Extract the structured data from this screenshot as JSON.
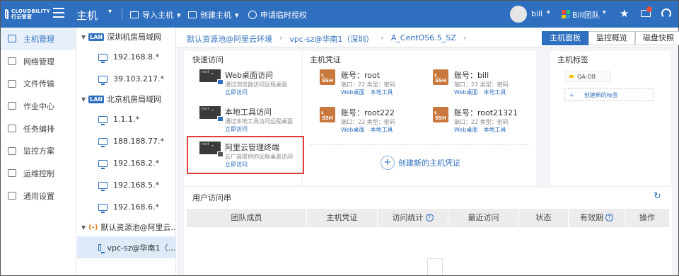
{
  "header": {
    "logo_text_line1": "CLOUDBILITY",
    "logo_text_line2": "行云管家",
    "title": "主机",
    "actions": [
      {
        "label": "导入主机",
        "icon": "import-icon"
      },
      {
        "label": "创建主机",
        "icon": "create-host-icon"
      },
      {
        "label": "申请临时授权",
        "icon": "clock-icon"
      }
    ],
    "user": "bill",
    "team": "Bill团队"
  },
  "left_nav": {
    "items": [
      {
        "label": "主机管理",
        "icon": "monitor-icon",
        "active": true
      },
      {
        "label": "网络管理",
        "icon": "network-icon",
        "active": false
      },
      {
        "label": "文件传输",
        "icon": "file-transfer-icon",
        "active": false
      },
      {
        "label": "作业中心",
        "icon": "job-center-icon",
        "active": false
      },
      {
        "label": "任务编排",
        "icon": "task-icon",
        "active": false
      },
      {
        "label": "监控方案",
        "icon": "monitoring-icon",
        "active": false
      },
      {
        "label": "运维控制",
        "icon": "ops-control-icon",
        "active": false
      },
      {
        "label": "通用设置",
        "icon": "settings-icon",
        "active": false
      }
    ]
  },
  "host_tree": {
    "groups": [
      {
        "badge": "LAN",
        "label": "深圳机房局域网",
        "hosts": [
          "192.168.8.*",
          "39.103.217.*"
        ]
      },
      {
        "badge": "LAN",
        "label": "北京机房局域网",
        "hosts": [
          "1.1.1.*",
          "188.188.77.*",
          "192.168.2.*",
          "192.168.5.*",
          "192.168.6.*"
        ]
      },
      {
        "badge": "(-)",
        "label": "默认资源池@阿里云...",
        "hosts": [
          "vpc-sz@华南1（..."
        ]
      }
    ]
  },
  "breadcrumb": [
    "默认资源池@阿里云环境",
    "vpc-sz@华南1（深圳）",
    "A_CentOS6.5_SZ"
  ],
  "view_tabs": [
    "主机面板",
    "监控概览",
    "磁盘快照"
  ],
  "quick_access": {
    "title": "快速访问",
    "items": [
      {
        "title": "Web桌面访问",
        "desc": "通过浏览器访问远程桌面",
        "link": "立即访问"
      },
      {
        "title": "本地工具访问",
        "desc": "通过本地工具访问远程桌面",
        "link": "立即访问"
      },
      {
        "title": "阿里云管理终端",
        "desc": "云厂商提供的远程桌面访问",
        "link": "立即访问"
      }
    ]
  },
  "credentials": {
    "title": "主机凭证",
    "items": [
      {
        "account": "账号：root",
        "meta": "端口：22  类型：密码",
        "links": [
          "Web桌面",
          "本地工具"
        ]
      },
      {
        "account": "账号：bill",
        "meta": "端口：22  类型：密码",
        "links": [
          "Web桌面",
          "本地工具"
        ]
      },
      {
        "account": "账号：root222",
        "meta": "端口：22  类型：密码",
        "links": [
          "Web桌面",
          "本地工具"
        ]
      },
      {
        "account": "账号：root21321",
        "meta": "端口：22  类型：密码",
        "links": [
          "Web桌面",
          "本地工具"
        ]
      }
    ],
    "badge": "SSH",
    "create_label": "创建新的主机凭证"
  },
  "tags": {
    "title": "主机标签",
    "items": [
      "QA-DB"
    ],
    "create_label": "创建新的标签"
  },
  "access_log": {
    "title": "用户访问串",
    "columns": [
      "团队成员",
      "主机凭证",
      "访问统计",
      "最近访问",
      "状态",
      "有效期",
      "操作"
    ]
  },
  "colors": {
    "primary": "#2f6fbf",
    "highlight": "#e03c3c",
    "ssh": "#c8783c"
  }
}
